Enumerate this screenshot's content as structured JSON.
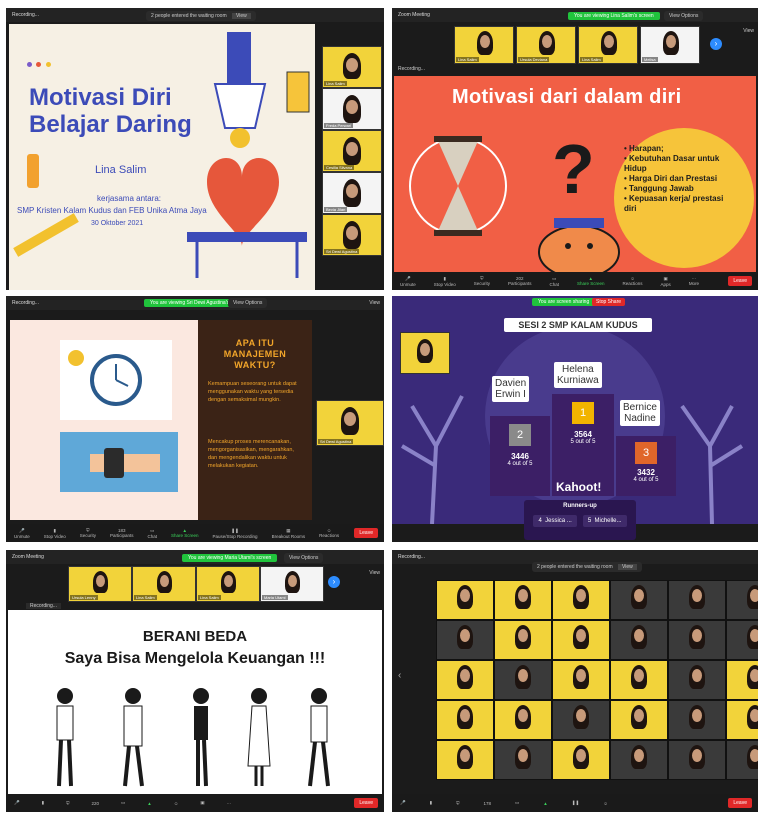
{
  "panel1": {
    "topbar": "Recording...",
    "waiting_notice": "2 people entered the waiting room",
    "view_button": "View",
    "slide": {
      "title_line1": "Motivasi Diri",
      "title_line2": "Belajar Daring",
      "presenter": "Lina Salim",
      "kerjasama": "kerjasama antara:",
      "organizations": "SMP Kristen Kalam Kudus dan FEB Unika Atma Jaya",
      "date": "30 Oktober 2021"
    },
    "participants": [
      "Lina Salim",
      "Freda Perwari",
      "Cesilia Silvana",
      "Bevia Jilan",
      "Sri Dewi Agustina"
    ]
  },
  "panel2": {
    "window_title": "Zoom Meeting",
    "sharing_notice": "You are viewing Lina Salim's screen",
    "view_options": "View Options",
    "view_label": "View",
    "participants": [
      "Lina Salim",
      "Ursula Deviana",
      "Lina Salim",
      "Melisa"
    ],
    "recording": "Recording...",
    "slide": {
      "title": "Motivasi dari dalam diri",
      "points": [
        "Harapan;",
        "Kebutuhan Dasar untuk Hidup",
        "Harga Diri dan Prestasi",
        "Tanggung Jawab",
        "Kepuasan kerja/ prestasi diri"
      ]
    },
    "toolbar": [
      "Unmute",
      "Stop Video",
      "Security",
      "Participants",
      "Chat",
      "Share Screen",
      "Reactions",
      "Apps",
      "More"
    ],
    "participant_count": "202",
    "leave": "Leave"
  },
  "panel3": {
    "recording": "Recording...",
    "sharing_notice": "You are viewing Sri Dewi Agustina's screen",
    "view_options": "View Options",
    "view_label": "View",
    "slide": {
      "title_line1": "APA ITU",
      "title_line2": "MANAJEMEN",
      "title_line3": "WAKTU?",
      "para1": "Kemampuan seseorang untuk dapat menggunakan waktu yang tersedia dengan semaksimal mungkin.",
      "para2": "Mencakup proses merencanakan, mengorganisasikan, mengarahkan, dan mengendalikan waktu untuk melakukan kegiatan."
    },
    "participant": "Sri Dewi Agustina",
    "toolbar": [
      "Unmute",
      "Stop Video",
      "Security",
      "Participants",
      "Chat",
      "Share Screen",
      "Pause/Stop Recording",
      "Breakout Rooms",
      "Reactions"
    ],
    "participant_count": "183",
    "leave": "Leave"
  },
  "panel4": {
    "sharing_notice": "You are screen sharing",
    "stop_share": "Stop Share",
    "kahoot_header": "SESI 2 SMP KALAM KUDUS",
    "podium": [
      {
        "rank": "2",
        "name_line1": "Davien",
        "name_line2": "Erwin I",
        "score": "3446",
        "correct": "4 out of 5"
      },
      {
        "rank": "1",
        "name_line1": "Helena",
        "name_line2": "Kurniawa",
        "score": "3564",
        "correct": "5 out of 5"
      },
      {
        "rank": "3",
        "name_line1": "Bernice",
        "name_line2": "Nadine",
        "score": "3432",
        "correct": "4 out of 5"
      }
    ],
    "logo": "Kahoot!",
    "runners_up_title": "Runners-up",
    "runners_up": [
      {
        "rank": "4",
        "name": "Jessica ..."
      },
      {
        "rank": "5",
        "name": "Michelle..."
      }
    ]
  },
  "panel5": {
    "window_title": "Zoom Meeting",
    "sharing_notice": "You are viewing Maria Utami's screen",
    "view_options": "View Options",
    "view_label": "View",
    "participants": [
      "Ursula Lenny",
      "Lina Salim",
      "Lina Salim",
      "Maria Utami"
    ],
    "recording": "Recording...",
    "slide": {
      "title": "BERANI BEDA",
      "subtitle": "Saya Bisa Mengelola Keuangan !!!"
    },
    "participant_count": "220",
    "leave": "Leave"
  },
  "panel6": {
    "recording": "Recording...",
    "waiting_notice": "2 people entered the waiting room",
    "view_button": "View",
    "participant_count": "178",
    "leave": "Leave"
  }
}
